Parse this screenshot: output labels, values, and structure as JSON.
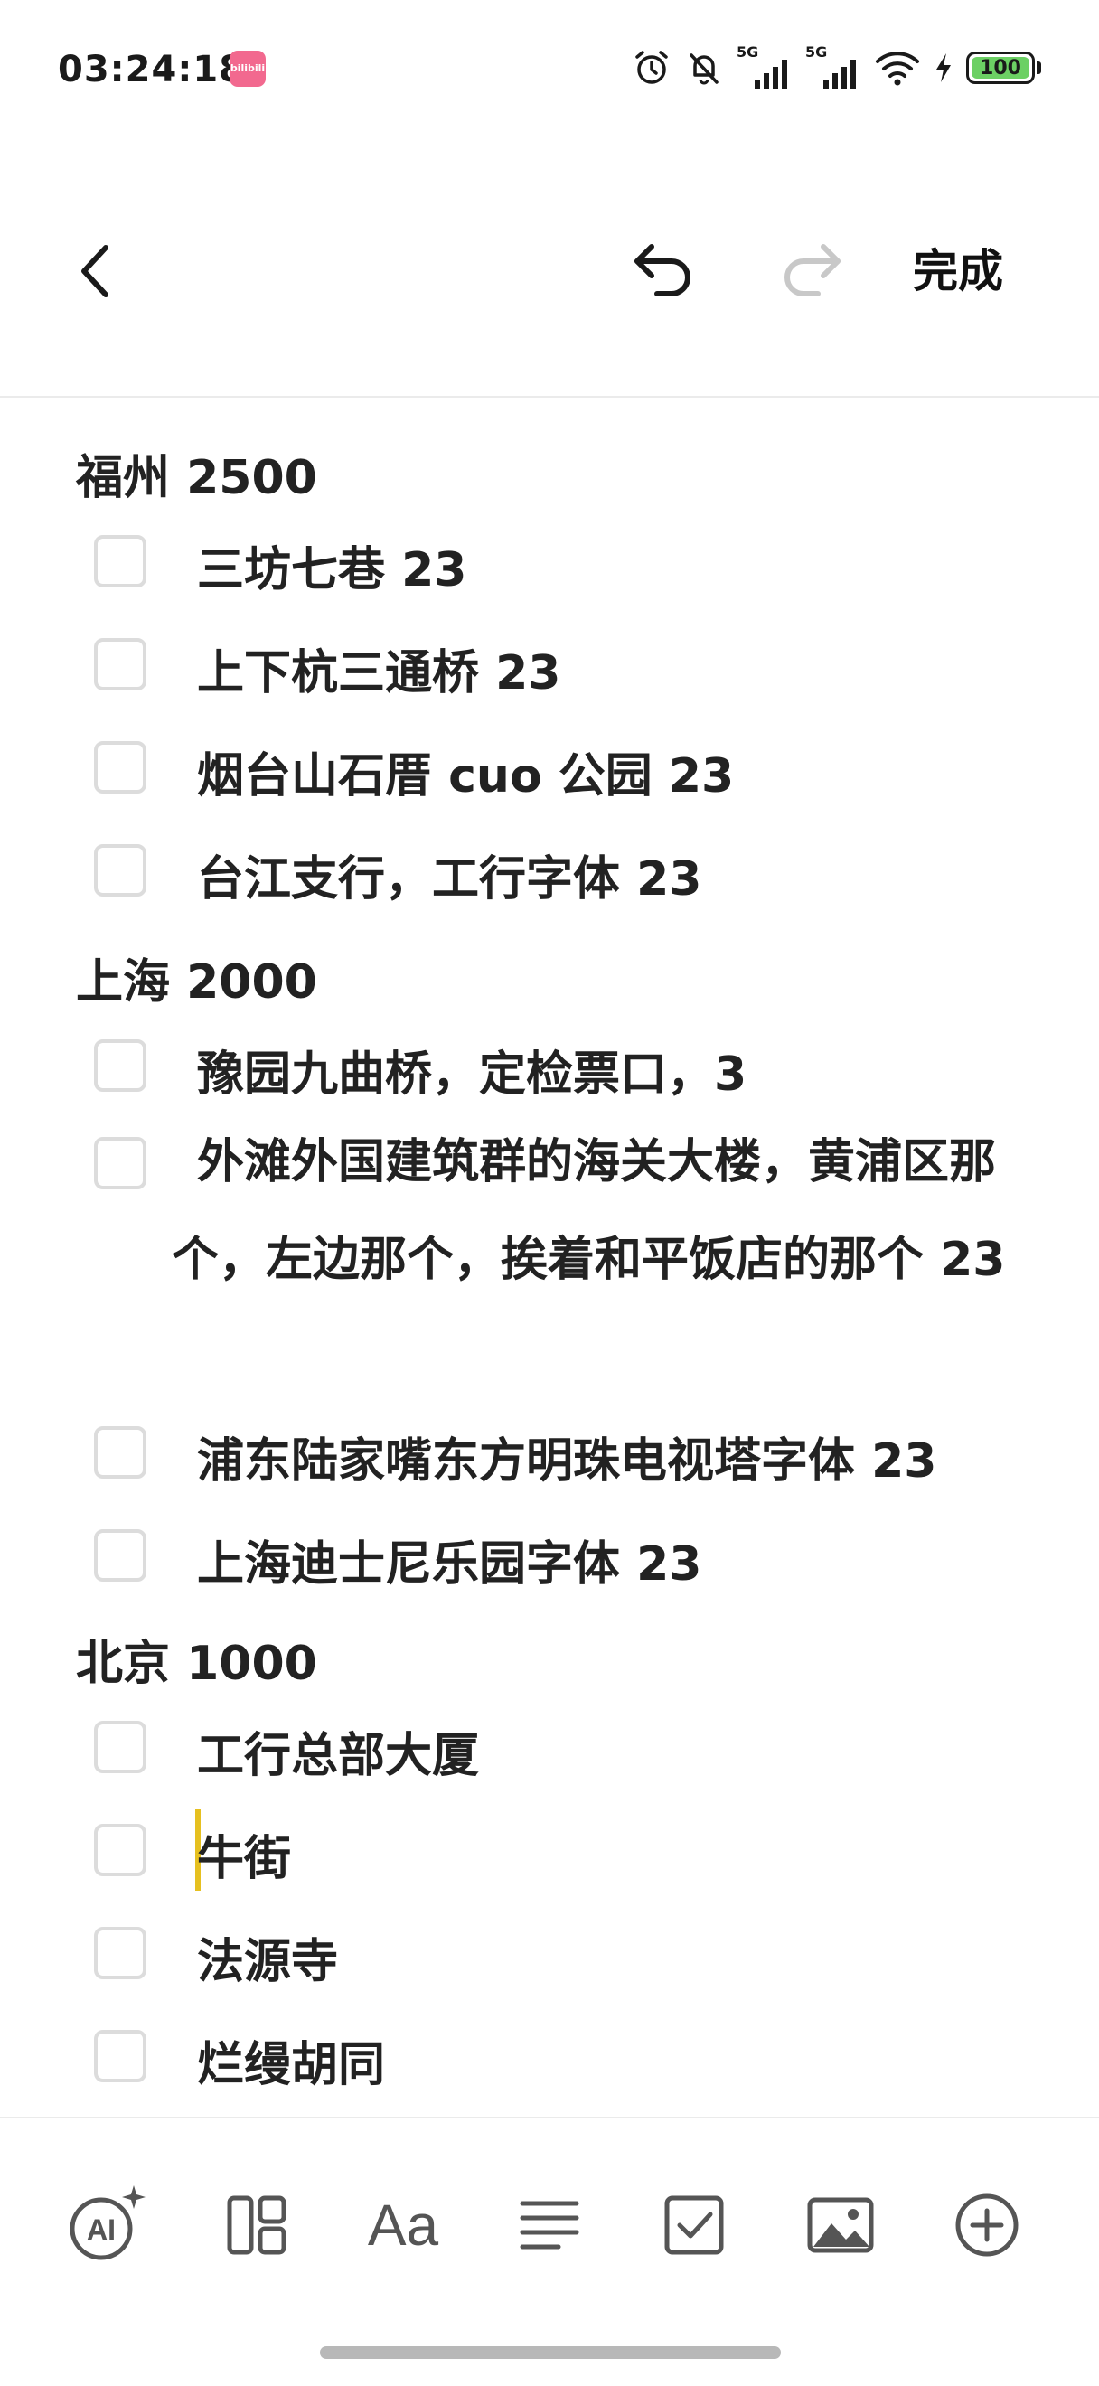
{
  "status_bar": {
    "time": "03:24:18",
    "app_badge": "bilibili",
    "network_1": "5G",
    "network_2": "5G",
    "battery": "100"
  },
  "nav": {
    "back_icon": "chevron-left-icon",
    "undo_icon": "undo-icon",
    "redo_icon": "redo-icon",
    "done_label": "完成"
  },
  "note": {
    "sections": [
      {
        "title": "福州 2500",
        "items": [
          "三坊七巷 23",
          "上下杭三通桥 23",
          "烟台山石厝 cuo 公园 23",
          "台江支行，工行字体 23"
        ]
      },
      {
        "title": "上海 2000",
        "items": [
          "豫园九曲桥，定检票口，3",
          "外滩外国建筑群的海关大楼，黄浦区那个，左边那个，挨着和平饭店的那个 23",
          "浦东陆家嘴东方明珠电视塔字体 23",
          "上海迪士尼乐园字体 23"
        ]
      },
      {
        "title": "北京 1000",
        "items": [
          "工行总部大厦",
          "牛街",
          "法源寺",
          "烂缦胡同"
        ]
      }
    ]
  },
  "toolbar": {
    "icons": [
      "ai-sparkle-icon",
      "layout-icon",
      "text-format-icon",
      "align-icon",
      "checklist-icon",
      "image-icon",
      "add-icon"
    ],
    "text_format_label": "Aa",
    "ai_label": "AI"
  },
  "colors": {
    "accent_cursor": "#e6c020",
    "battery_fill": "#6cd064",
    "checkbox_border": "#dcdcdc"
  }
}
